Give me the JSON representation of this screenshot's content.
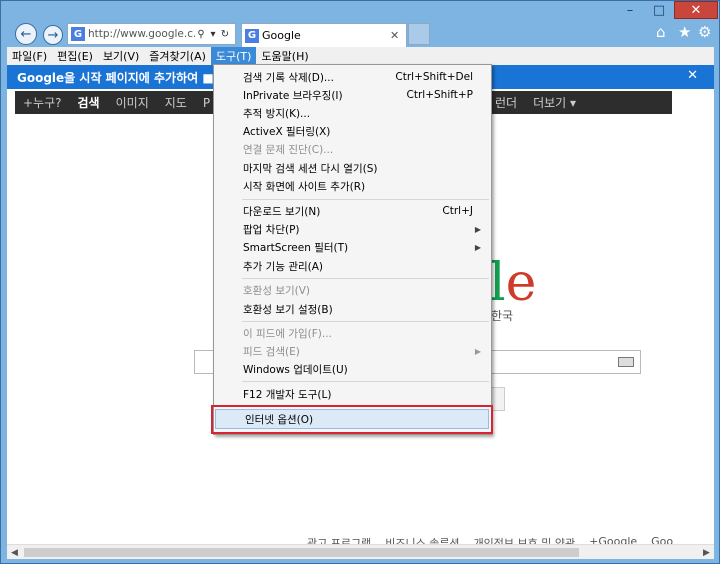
{
  "browser": {
    "address": "http://www.google.c...",
    "tab_title": "Google",
    "favicon": "G",
    "icons": {
      "back": "back-arrow-icon",
      "forward": "forward-arrow-icon",
      "search": "search-icon",
      "dropdown": "chevron-down-icon",
      "refresh": "refresh-icon",
      "home": "home-icon",
      "favorites": "star-icon",
      "tools": "gear-icon"
    }
  },
  "menubar": {
    "items": [
      "파일(F)",
      "편집(E)",
      "보기(V)",
      "즐겨찾기(A)",
      "도구(T)",
      "도움말(H)"
    ],
    "active": "도구(T)"
  },
  "infobar": {
    "text": "Google을 시작 페이지에 추가하여 ■"
  },
  "google_bar": {
    "left": [
      "+누구?",
      "검색",
      "이미지",
      "지도",
      "P"
    ],
    "right": [
      "더보기 ▾"
    ],
    "right_partial": "런더"
  },
  "page": {
    "logo_fragment_l": "l",
    "logo_fragment_e": "e",
    "logo_sub": "한국",
    "lucky_fragment": "y",
    "footer": [
      "광고 프로그램",
      "비즈니스 솔루션",
      "개인정보 보호 및 약관",
      "+Google",
      "Goo"
    ]
  },
  "tools_menu": {
    "groups": [
      [
        {
          "label": "검색 기록 삭제(D)...",
          "shortcut": "Ctrl+Shift+Del",
          "disabled": false
        },
        {
          "label": "InPrivate 브라우징(I)",
          "shortcut": "Ctrl+Shift+P",
          "disabled": false
        },
        {
          "label": "추적 방지(K)...",
          "disabled": false
        },
        {
          "label": "ActiveX 필터링(X)",
          "disabled": false
        },
        {
          "label": "연결 문제 진단(C)...",
          "disabled": true
        },
        {
          "label": "마지막 검색 세션 다시 열기(S)",
          "disabled": false
        },
        {
          "label": "시작 화면에 사이트 추가(R)",
          "disabled": false
        }
      ],
      [
        {
          "label": "다운로드 보기(N)",
          "shortcut": "Ctrl+J",
          "disabled": false
        },
        {
          "label": "팝업 차단(P)",
          "submenu": true,
          "disabled": false
        },
        {
          "label": "SmartScreen 필터(T)",
          "submenu": true,
          "disabled": false
        },
        {
          "label": "추가 기능 관리(A)",
          "disabled": false
        }
      ],
      [
        {
          "label": "호환성 보기(V)",
          "disabled": true
        },
        {
          "label": "호환성 보기 설정(B)",
          "disabled": false
        }
      ],
      [
        {
          "label": "이 피드에 가입(F)...",
          "disabled": true
        },
        {
          "label": "피드 검색(E)",
          "submenu": true,
          "disabled": true
        },
        {
          "label": "Windows 업데이트(U)",
          "disabled": false
        }
      ],
      [
        {
          "label": "F12 개발자 도구(L)",
          "disabled": false
        }
      ],
      [
        {
          "label": "인터넷 옵션(O)",
          "disabled": false,
          "highlighted": true
        }
      ]
    ]
  },
  "colors": {
    "infobar": "#1a74d6",
    "menu_active": "#3a8ad8",
    "highlight_box": "#d8242e",
    "close_button": "#c9463d"
  }
}
